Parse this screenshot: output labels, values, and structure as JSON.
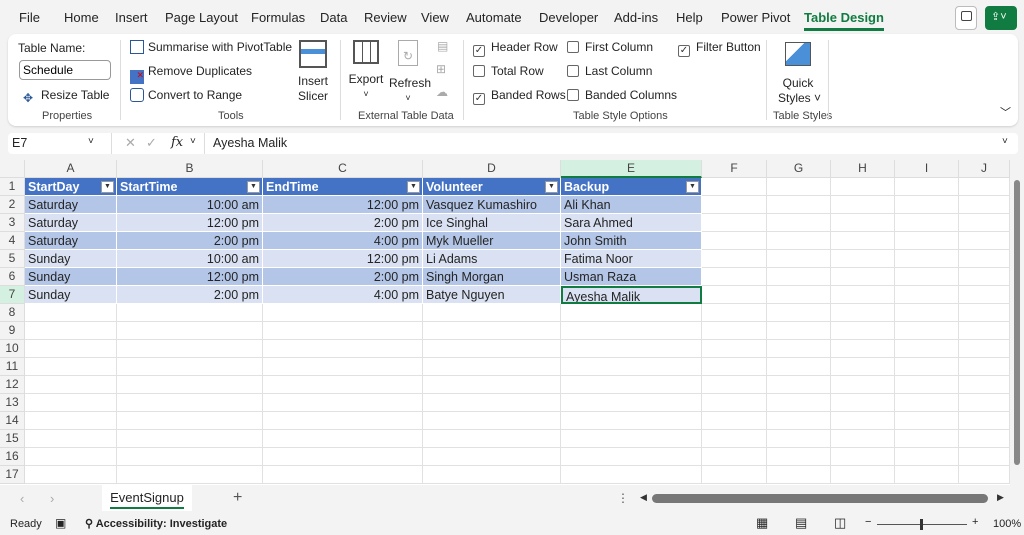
{
  "menu": [
    "File",
    "Home",
    "Insert",
    "Page Layout",
    "Formulas",
    "Data",
    "Review",
    "View",
    "Automate",
    "Developer",
    "Add-ins",
    "Help",
    "Power Pivot",
    "Table Design"
  ],
  "ribbon": {
    "table_name_label": "Table Name:",
    "table_name_value": "Schedule",
    "resize_table": "Resize Table",
    "properties": "Properties",
    "summarise": "Summarise with PivotTable",
    "remove_duplicates": "Remove Duplicates",
    "convert_to_range": "Convert to Range",
    "insert_slicer_1": "Insert",
    "insert_slicer_2": "Slicer",
    "tools": "Tools",
    "export": "Export",
    "refresh": "Refresh",
    "external": "External Table Data",
    "header_row": "Header Row",
    "total_row": "Total Row",
    "banded_rows": "Banded Rows",
    "first_column": "First Column",
    "last_column": "Last Column",
    "banded_columns": "Banded Columns",
    "filter_button": "Filter Button",
    "style_options": "Table Style Options",
    "quick_1": "Quick",
    "quick_2": "Styles",
    "table_styles": "Table Styles"
  },
  "formula_bar": {
    "name_box": "E7",
    "fx": "fx",
    "value": "Ayesha Malik"
  },
  "columns": [
    "A",
    "B",
    "C",
    "D",
    "E",
    "F",
    "G",
    "H",
    "I",
    "J"
  ],
  "rows": [
    "1",
    "2",
    "3",
    "4",
    "5",
    "6",
    "7",
    "8",
    "9",
    "10",
    "11",
    "12",
    "13",
    "14",
    "15",
    "16",
    "17"
  ],
  "table": {
    "headers": [
      "StartDay",
      "StartTime",
      "EndTime",
      "Volunteer",
      "Backup"
    ],
    "data": [
      [
        "Saturday",
        "10:00 am",
        "12:00 pm",
        "Vasquez Kumashiro",
        "Ali Khan"
      ],
      [
        "Saturday",
        "12:00 pm",
        "2:00 pm",
        "Ice Singhal",
        "Sara Ahmed"
      ],
      [
        "Saturday",
        "2:00 pm",
        "4:00 pm",
        "Myk Mueller",
        "John Smith"
      ],
      [
        "Sunday",
        "10:00 am",
        "12:00 pm",
        "Li Adams",
        "Fatima Noor"
      ],
      [
        "Sunday",
        "12:00 pm",
        "2:00 pm",
        "Singh Morgan",
        "Usman Raza"
      ],
      [
        "Sunday",
        "2:00 pm",
        "4:00 pm",
        "Batye Nguyen",
        "Ayesha Malik"
      ]
    ]
  },
  "sheet_tab": "EventSignup",
  "status": {
    "ready": "Ready",
    "accessibility": "Accessibility: Investigate",
    "zoom": "100%"
  }
}
